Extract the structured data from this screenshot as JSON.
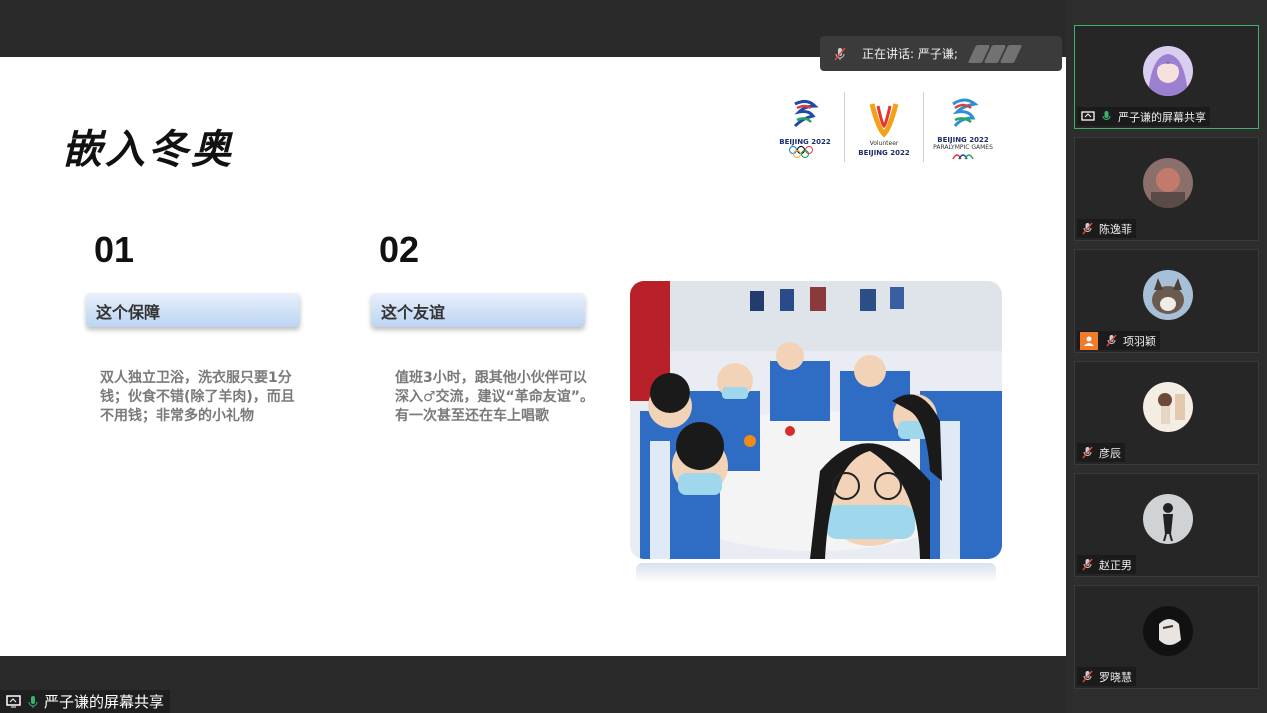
{
  "speaking": {
    "label": "正在讲话: 严子谦;"
  },
  "slide": {
    "title": "嵌入冬奥",
    "logos": [
      {
        "caption": "BEIJING 2022",
        "sub": ""
      },
      {
        "caption": "BEIJING 2022",
        "sub": "Volunteer"
      },
      {
        "caption": "BEIJING 2022",
        "sub": "PARALYMPIC GAMES"
      }
    ],
    "items": [
      {
        "number": "01",
        "tag": "这个保障",
        "text": "双人独立卫浴，洗衣服只要1分钱；伙食不错(除了羊肉)，而且不用钱；非常多的小礼物"
      },
      {
        "number": "02",
        "tag": "这个友谊",
        "text": "值班3小时，跟其他小伙伴可以深入♂交流，建议“革命友谊”。有一次甚至还在车上唱歌"
      }
    ]
  },
  "screen_share_label": "严子谦的屏幕共享",
  "participants": [
    {
      "name": "严子谦的屏幕共享",
      "active": true,
      "avatar_color": "#c9b6e8",
      "icons": [
        "screen-share-icon",
        "mic-icon"
      ]
    },
    {
      "name": "陈逸菲",
      "active": false,
      "avatar_color": "#c47a6a",
      "icons": [
        "mic-muted-icon"
      ]
    },
    {
      "name": "项羽颖",
      "active": false,
      "avatar_color": "#9fb4c9",
      "icons": [
        "person-icon",
        "mic-muted-icon"
      ]
    },
    {
      "name": "彦辰",
      "active": false,
      "avatar_color": "#efe5d8",
      "icons": [
        "mic-muted-icon"
      ]
    },
    {
      "name": "赵正男",
      "active": false,
      "avatar_color": "#c9cdd0",
      "icons": [
        "mic-muted-icon"
      ]
    },
    {
      "name": "罗晓慧",
      "active": false,
      "avatar_color": "#1a1a1a",
      "icons": [
        "mic-muted-icon"
      ]
    }
  ],
  "colors": {
    "active_border": "#3bb36b",
    "accent_green": "#3bb36b",
    "mute_red": "#e04848",
    "tag_blue": "#bcd4f2"
  }
}
